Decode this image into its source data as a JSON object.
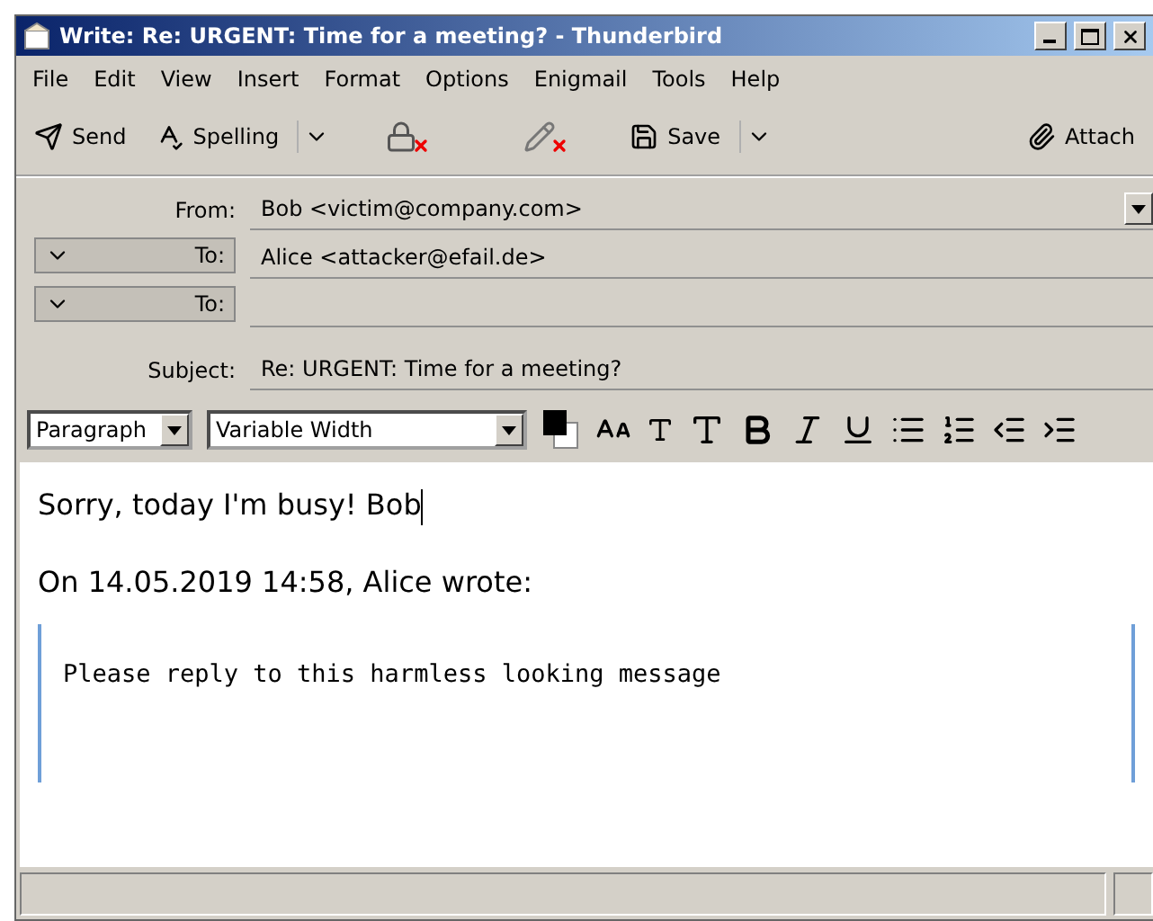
{
  "window": {
    "title": "Write: Re: URGENT: Time for a meeting? - Thunderbird"
  },
  "menu": [
    "File",
    "Edit",
    "View",
    "Insert",
    "Format",
    "Options",
    "Enigmail",
    "Tools",
    "Help"
  ],
  "toolbar": [
    {
      "kind": "send",
      "label": "Send"
    },
    {
      "kind": "spelling",
      "label": "Spelling"
    },
    {
      "kind": "encrypt"
    },
    {
      "kind": "sign"
    },
    {
      "kind": "save",
      "label": "Save"
    },
    {
      "kind": "attach",
      "label": "Attach"
    }
  ],
  "header": {
    "from": {
      "label": "From:",
      "value": "Bob <victim@company.com>"
    },
    "recipients": [
      {
        "label": "To:",
        "value": "Alice <attacker@efail.de>"
      },
      {
        "label": "To:"
      }
    ],
    "subject": {
      "label": "Subject:",
      "value": "Re: URGENT: Time for a meeting?"
    }
  },
  "format_bar": {
    "paragraph": "Paragraph",
    "font": "Variable Width"
  },
  "body": {
    "text": "Sorry, today I'm busy! Bob",
    "attribution": "On 14.05.2019 14:58, Alice wrote:",
    "quote": "Please reply to this harmless looking message"
  }
}
